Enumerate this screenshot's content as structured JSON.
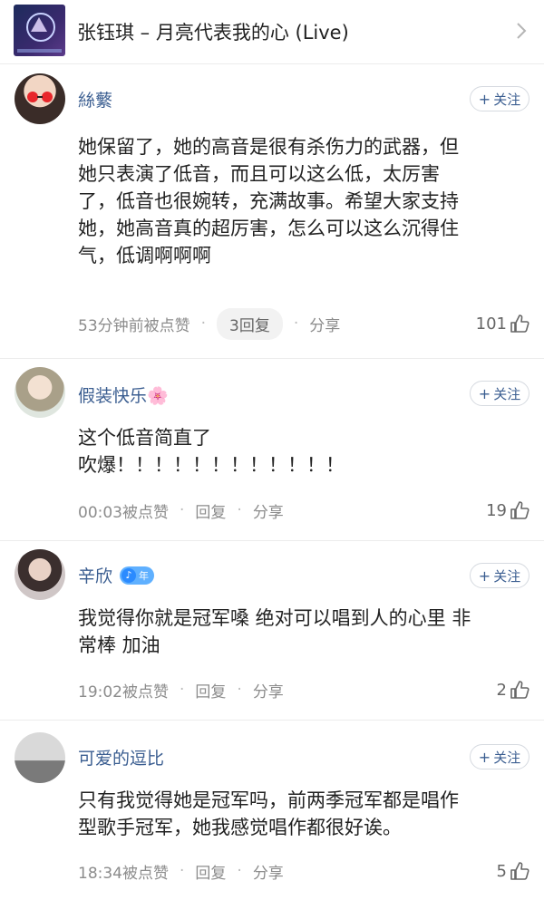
{
  "header": {
    "song_title": "张钰琪 – 月亮代表我的心 (Live)"
  },
  "follow_label": "关注",
  "comments": [
    {
      "username": "絲蘩",
      "text": "她保留了，她的高音是很有杀伤力的武器，但\n她只表演了低音，而且可以这么低，太厉害\n了，低音也很婉转，充满故事。希望大家支持\n她，她高音真的超厉害，怎么可以这么沉得住\n气，低调啊啊啊",
      "time": "53分钟前被点赞",
      "reply": "3回复",
      "share": "分享",
      "likes": "101"
    },
    {
      "username": "假装快乐🌸",
      "text": "这个低音简直了\n吹爆！！！！！！！！！！！！",
      "time": "00:03被点赞",
      "reply": "回复",
      "share": "分享",
      "likes": "19"
    },
    {
      "username": "辛欣",
      "badge": "年",
      "text": "我觉得你就是冠军嗓 绝对可以唱到人的心里 非\n常棒 加油",
      "time": "19:02被点赞",
      "reply": "回复",
      "share": "分享",
      "likes": "2"
    },
    {
      "username": "可爱的逗比",
      "text": "只有我觉得她是冠军吗，前两季冠军都是唱作\n型歌手冠军，她我感觉唱作都很好诶。",
      "time": "18:34被点赞",
      "reply": "回复",
      "share": "分享",
      "likes": "5"
    }
  ]
}
